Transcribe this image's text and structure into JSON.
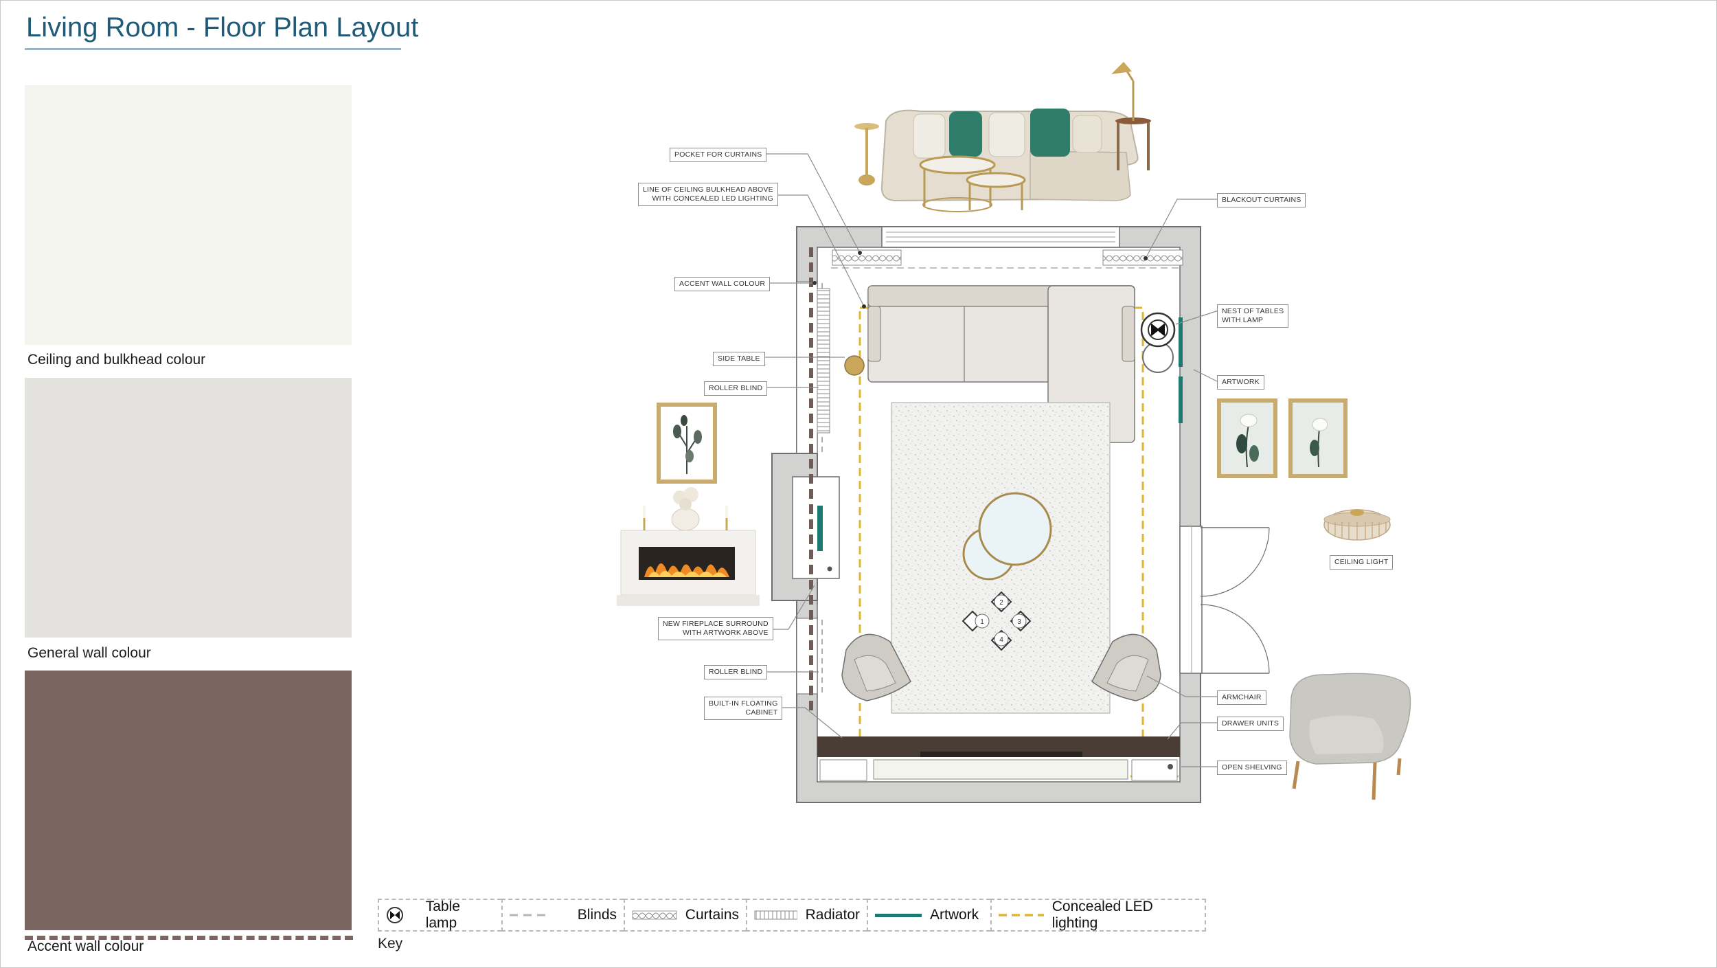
{
  "title": "Living Room - Floor Plan Layout",
  "colors": {
    "title": "#1f5a78",
    "ceiling": "#f4f4ef",
    "general_wall": "#e3e2de",
    "accent_wall": "#7a6560",
    "wall_grey": "#d2d2d0",
    "led": "#e0b530",
    "artwork": "#1e7a70",
    "cabinet": "#4a3d36"
  },
  "swatches": [
    {
      "label": "Ceiling and bulkhead colour"
    },
    {
      "label": "General wall colour"
    },
    {
      "label": "Accent wall colour"
    }
  ],
  "callouts": {
    "pocket_for_curtains": "POCKET FOR CURTAINS",
    "bulkhead_line1": "LINE OF CEILING BULKHEAD ABOVE",
    "bulkhead_line2": "WITH CONCEALED LED LIGHTING",
    "accent_wall_colour": "ACCENT WALL COLOUR",
    "side_table": "SIDE TABLE",
    "roller_blind_top": "ROLLER BLIND",
    "fireplace_line1": "NEW FIREPLACE SURROUND",
    "fireplace_line2": "WITH ARTWORK ABOVE",
    "roller_blind_bottom": "ROLLER BLIND",
    "cabinet_line1": "BUILT-IN FLOATING",
    "cabinet_line2": "CABINET",
    "blackout_curtains": "BLACKOUT CURTAINS",
    "nest_line1": "NEST OF TABLES",
    "nest_line2": "WITH LAMP",
    "artwork": "ARTWORK",
    "ceiling_light": "CEILING LIGHT",
    "armchair": "ARMCHAIR",
    "drawer_units": "DRAWER UNITS",
    "open_shelving": "OPEN SHELVING"
  },
  "ottomans": [
    "1",
    "2",
    "3",
    "4"
  ],
  "legend": {
    "table_lamp": "Table lamp",
    "blinds": "Blinds",
    "curtains": "Curtains",
    "radiator": "Radiator",
    "artwork": "Artwork",
    "led": "Concealed LED lighting",
    "key": "Key"
  },
  "icons": [
    "table-lamp-icon",
    "blinds-line-icon",
    "curtains-icon",
    "radiator-icon",
    "artwork-line-icon",
    "led-line-icon"
  ]
}
